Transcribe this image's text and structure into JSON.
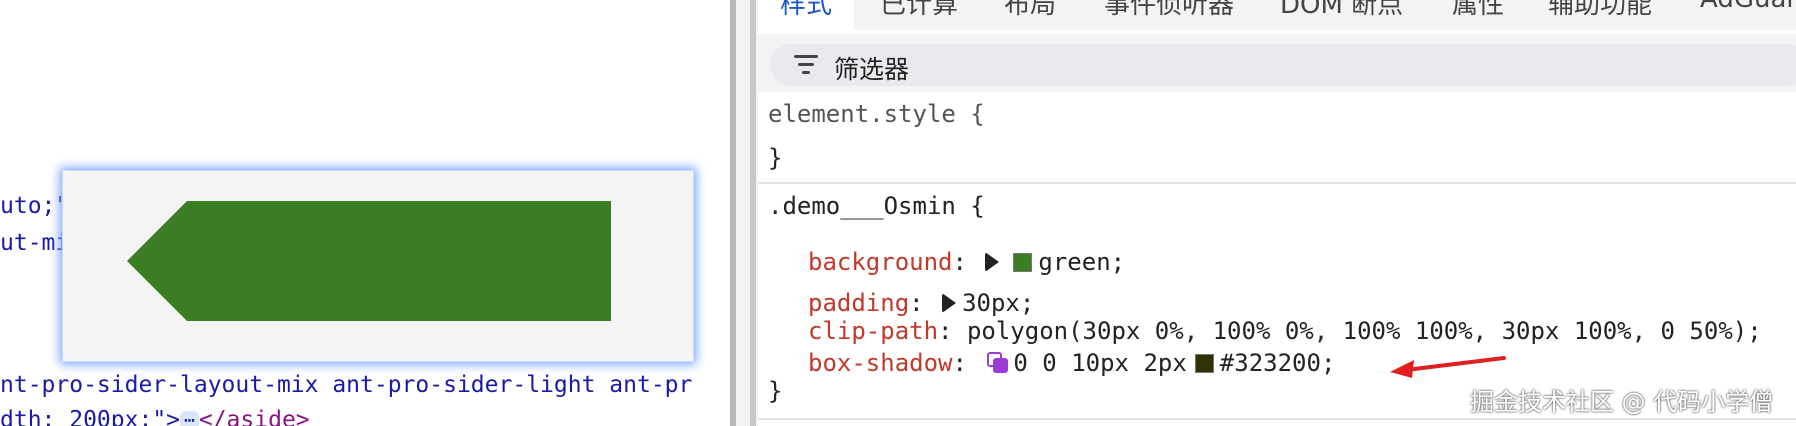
{
  "left_panel": {
    "code_lines": {
      "line1": "uto;\"",
      "line2": "ut-mi",
      "line3": "nt-pro-sider-layout-mix ant-pro-sider-light ant-pr",
      "line4_attr": "dth: 200px;\">",
      "line4_badge": "⋯",
      "line4_tag": "</aside>"
    },
    "preview_shape_color": "#3b7d22"
  },
  "devtools": {
    "tabs": [
      "样式",
      "已计算",
      "布局",
      "事件侦听器",
      "DOM 断点",
      "属性",
      "辅助功能",
      "AdGuar"
    ],
    "active_tab": "样式",
    "filter_label": "筛选器",
    "rules": [
      {
        "selector": "element.style {",
        "close": "}"
      },
      {
        "selector": ".demo___Osmin {",
        "close": "}",
        "declarations": {
          "background": {
            "name": "background",
            "value": "green;",
            "swatch": "#3b7d22"
          },
          "padding": {
            "name": "padding",
            "value": "30px;"
          },
          "clip_path": {
            "name": "clip-path",
            "value": "polygon(30px 0%, 100% 0%, 100% 100%, 30px 100%, 0 50%);"
          },
          "box_shadow": {
            "name": "box-shadow",
            "value_prefix": "0 0 10px 2px",
            "value_color": "#323200;",
            "swatch": "#323200"
          }
        }
      }
    ]
  },
  "watermark": "掘金技术社区 @ 代码小学僧"
}
